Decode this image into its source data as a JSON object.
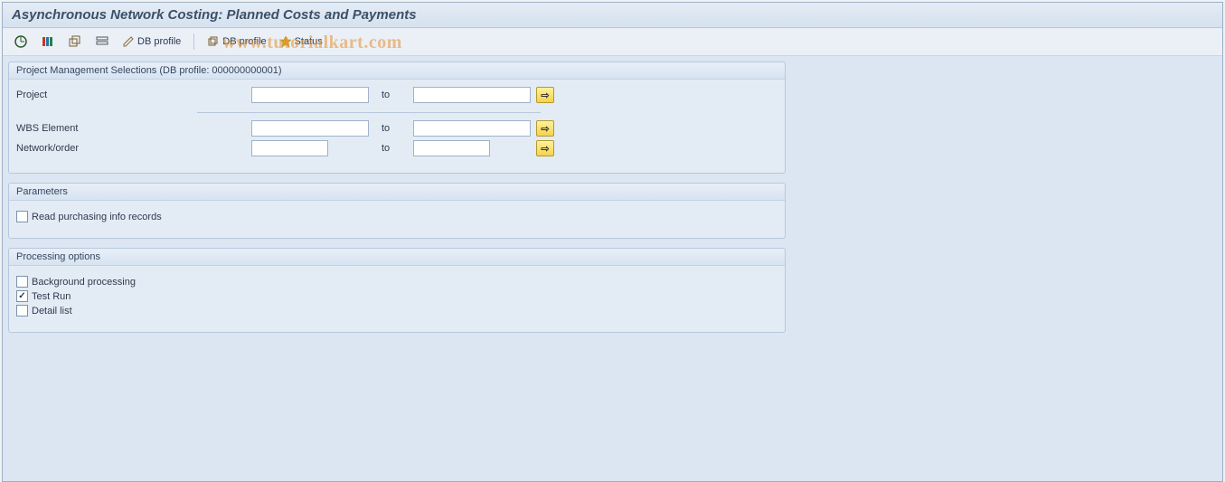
{
  "title": "Asynchronous Network Costing: Planned Costs and Payments",
  "watermark": "www.tutorialkart.com",
  "toolbar": {
    "db_profile_edit": "DB profile",
    "db_profile_copy": "DB profile",
    "status": "Status"
  },
  "selection_group": {
    "title": "Project Management Selections (DB profile: 000000000001)",
    "rows": [
      {
        "label": "Project",
        "from": "",
        "to_label": "to",
        "to": "",
        "wide": true
      },
      {
        "label": "WBS Element",
        "from": "",
        "to_label": "to",
        "to": "",
        "wide": true
      },
      {
        "label": "Network/order",
        "from": "",
        "to_label": "to",
        "to": "",
        "wide": false
      }
    ]
  },
  "parameters_group": {
    "title": "Parameters",
    "items": [
      {
        "label": "Read purchasing info records",
        "checked": false
      }
    ]
  },
  "processing_group": {
    "title": "Processing options",
    "items": [
      {
        "label": "Background processing",
        "checked": false
      },
      {
        "label": "Test Run",
        "checked": true
      },
      {
        "label": "Detail list",
        "checked": false
      }
    ]
  }
}
